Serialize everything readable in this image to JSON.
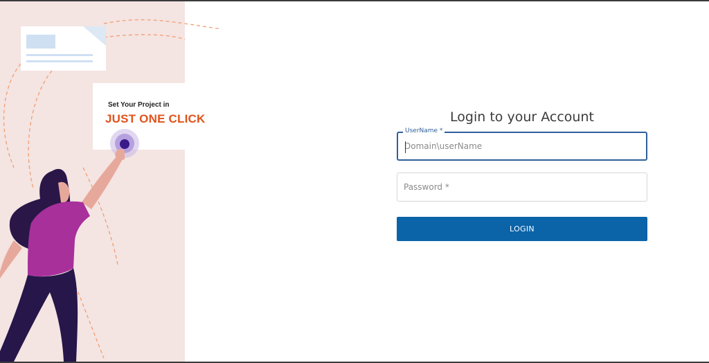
{
  "promo": {
    "line1": "Set Your Project in",
    "line2": "JUST ONE CLICK"
  },
  "login": {
    "title": "Login to your Account",
    "username": {
      "label": "UserName *",
      "placeholder": "Domain\\userName",
      "value": ""
    },
    "password": {
      "placeholder": "Password *",
      "value": ""
    },
    "button_label": "LOGIN"
  },
  "colors": {
    "accent": "#0b63a8",
    "focus_border": "#2f5f9a",
    "promo_orange": "#e0531c",
    "panel_bg": "#f4e4e2",
    "shirt": "#a8309b",
    "hair": "#2a1748"
  }
}
